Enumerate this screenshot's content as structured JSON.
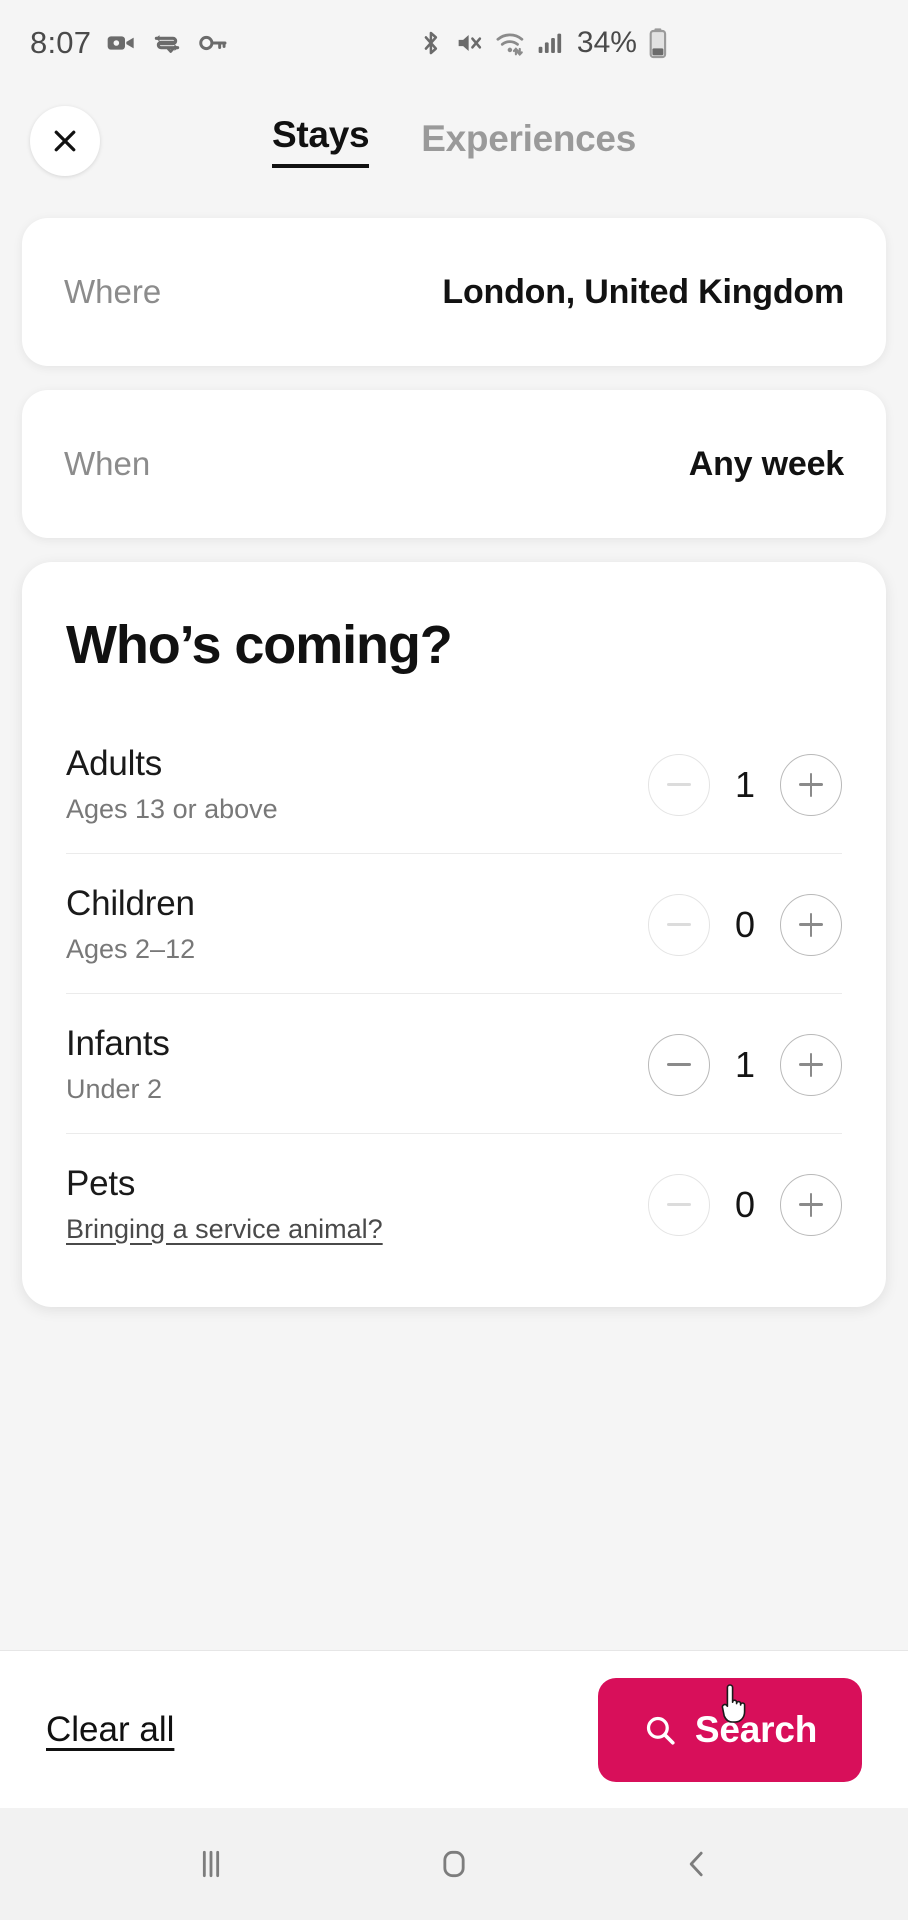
{
  "status_bar": {
    "time": "8:07",
    "battery_percent": "34%",
    "left_icons": [
      "video-camera-icon",
      "vpn-sync-icon",
      "key-icon"
    ],
    "right_icons": [
      "bluetooth-icon",
      "mute-icon",
      "wifi-icon",
      "signal-icon",
      "battery-icon"
    ]
  },
  "header": {
    "close_icon": "close-icon",
    "tabs": [
      {
        "label": "Stays",
        "active": true
      },
      {
        "label": "Experiences",
        "active": false
      }
    ]
  },
  "search_fields": {
    "where": {
      "label": "Where",
      "value": "London, United Kingdom"
    },
    "when": {
      "label": "When",
      "value": "Any week"
    }
  },
  "guests": {
    "title": "Who’s coming?",
    "rows": [
      {
        "name": "Adults",
        "subtitle": "Ages 13 or above",
        "subtitle_is_link": false,
        "count": "1",
        "minus_enabled": false,
        "plus_enabled": true
      },
      {
        "name": "Children",
        "subtitle": "Ages 2–12",
        "subtitle_is_link": false,
        "count": "0",
        "minus_enabled": false,
        "plus_enabled": true
      },
      {
        "name": "Infants",
        "subtitle": "Under 2",
        "subtitle_is_link": false,
        "count": "1",
        "minus_enabled": true,
        "plus_enabled": true
      },
      {
        "name": "Pets",
        "subtitle": "Bringing a service animal?",
        "subtitle_is_link": true,
        "count": "0",
        "minus_enabled": false,
        "plus_enabled": true
      }
    ]
  },
  "bottom_bar": {
    "clear_all_label": "Clear all",
    "search_label": "Search",
    "search_icon": "search-icon",
    "search_button_color": "#d80f5a"
  },
  "nav_bar": {
    "recents_icon": "recents-icon",
    "home_icon": "home-icon",
    "back_icon": "back-icon"
  },
  "colors": {
    "accent": "#d80f5a",
    "page_bg": "#f5f5f5",
    "card_bg": "#ffffff",
    "text_primary": "#111111",
    "text_muted": "#8c8c8c"
  }
}
